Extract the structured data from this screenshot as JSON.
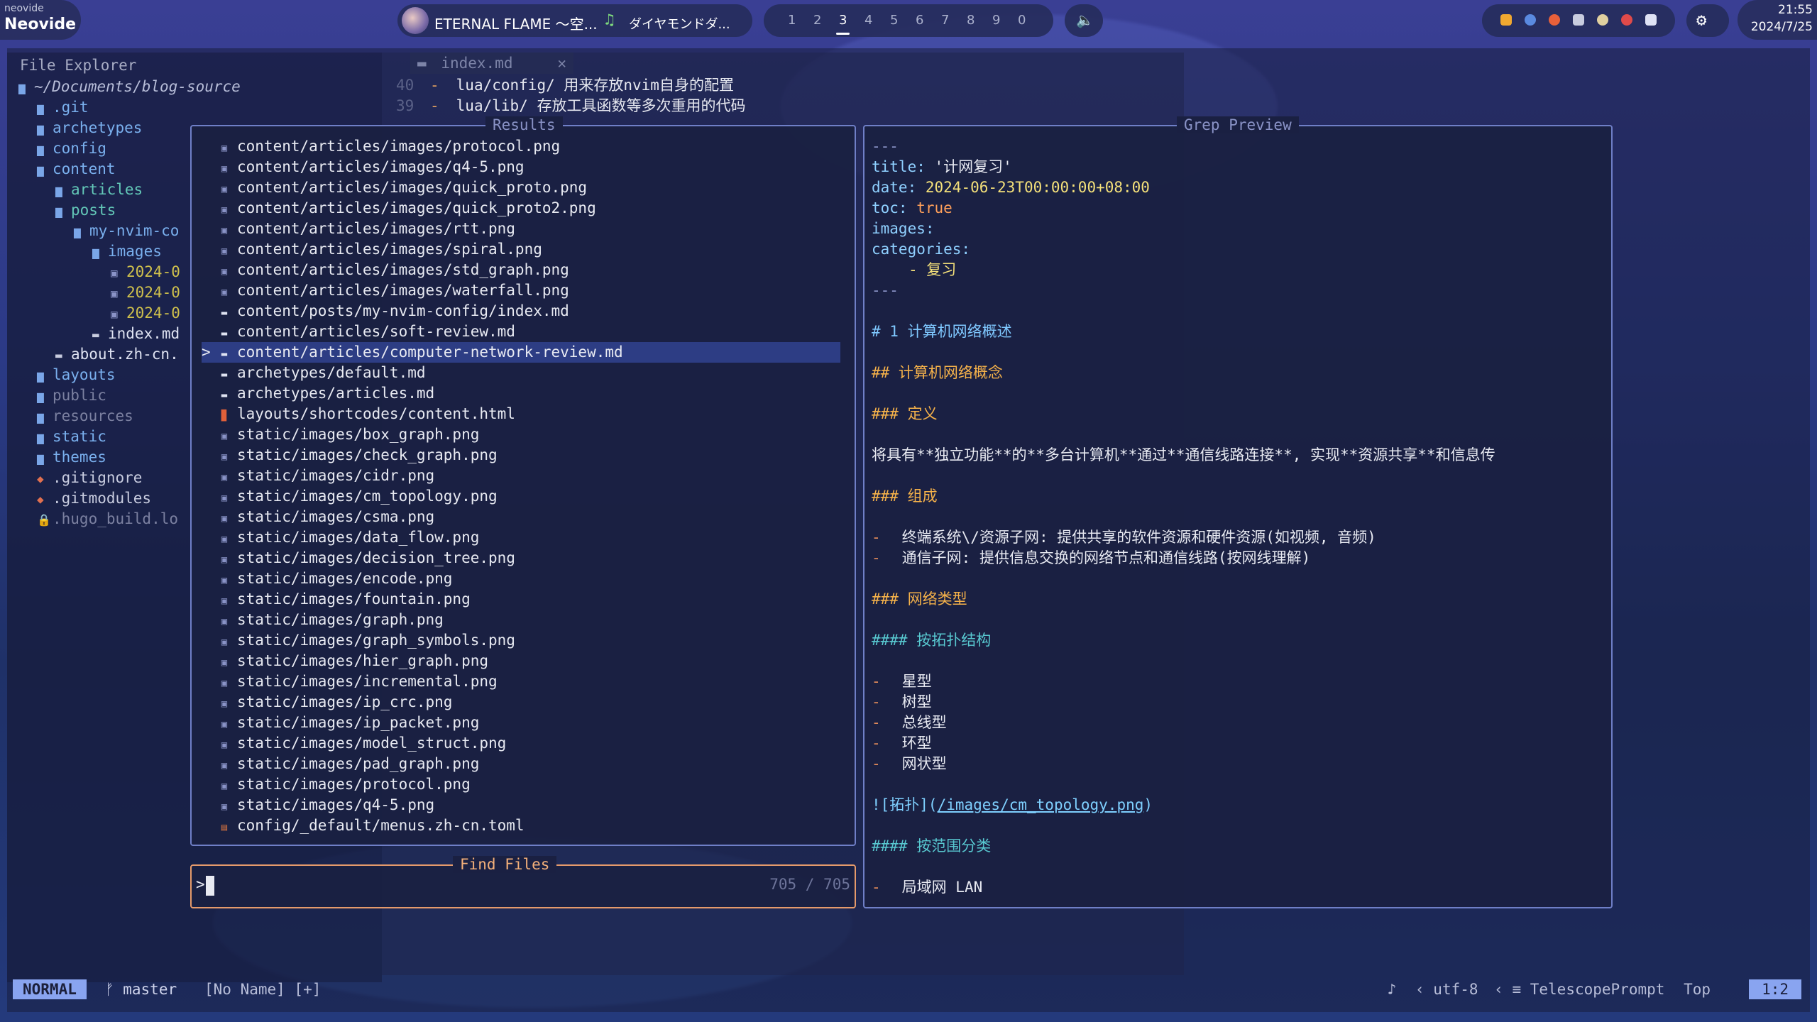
{
  "topbar": {
    "app_sub": "neovide",
    "app_name": "Neovide",
    "music_title": "ETERNAL FLAME 〜空...",
    "music_artist": "ダイヤモンドダ...",
    "workspaces": [
      "1",
      "2",
      "3",
      "4",
      "5",
      "6",
      "7",
      "8",
      "9",
      "0"
    ],
    "active_workspace": "3",
    "time": "21:55",
    "date": "2024/7/25"
  },
  "explorer": {
    "title": "File Explorer",
    "root": "~/Documents/blog-source",
    "items": [
      {
        "label": ".git",
        "type": "dir",
        "depth": 1
      },
      {
        "label": "archetypes",
        "type": "dir",
        "depth": 1
      },
      {
        "label": "config",
        "type": "dir",
        "depth": 1
      },
      {
        "label": "content",
        "type": "dir",
        "depth": 1
      },
      {
        "label": "articles",
        "type": "dir",
        "depth": 2
      },
      {
        "label": "posts",
        "type": "dir",
        "depth": 2
      },
      {
        "label": "my-nvim-co",
        "type": "dir",
        "depth": 3
      },
      {
        "label": "images",
        "type": "dir",
        "depth": 4
      },
      {
        "label": "2024-0",
        "type": "img",
        "depth": 5
      },
      {
        "label": "2024-0",
        "type": "img",
        "depth": 5
      },
      {
        "label": "2024-0",
        "type": "img",
        "depth": 5
      },
      {
        "label": "index.md",
        "type": "md",
        "depth": 4
      },
      {
        "label": "about.zh-cn.",
        "type": "md",
        "depth": 2
      },
      {
        "label": "layouts",
        "type": "dir",
        "depth": 1
      },
      {
        "label": "public",
        "type": "dim",
        "depth": 1
      },
      {
        "label": "resources",
        "type": "dim",
        "depth": 1
      },
      {
        "label": "static",
        "type": "dir",
        "depth": 1
      },
      {
        "label": "themes",
        "type": "dir",
        "depth": 1
      },
      {
        "label": ".gitignore",
        "type": "git",
        "depth": 1
      },
      {
        "label": ".gitmodules",
        "type": "git",
        "depth": 1
      },
      {
        "label": ".hugo_build.lo",
        "type": "lock",
        "depth": 1
      }
    ]
  },
  "editor": {
    "tab": "index.md",
    "lines": [
      {
        "ln": "40",
        "text": "lua/config/ 用来存放nvim自身的配置"
      },
      {
        "ln": "39",
        "text": "lua/lib/ 存放工具函数等多次重用的代码"
      }
    ]
  },
  "telescope": {
    "results_title": "Results",
    "preview_title": "Grep Preview",
    "prompt_title": "Find Files",
    "prompt_symbol": ">",
    "count": "705 / 705",
    "selected_index": 10,
    "results": [
      {
        "path": "content/articles/images/protocol.png",
        "icon": "img"
      },
      {
        "path": "content/articles/images/q4-5.png",
        "icon": "img"
      },
      {
        "path": "content/articles/images/quick_proto.png",
        "icon": "img"
      },
      {
        "path": "content/articles/images/quick_proto2.png",
        "icon": "img"
      },
      {
        "path": "content/articles/images/rtt.png",
        "icon": "img"
      },
      {
        "path": "content/articles/images/spiral.png",
        "icon": "img"
      },
      {
        "path": "content/articles/images/std_graph.png",
        "icon": "img"
      },
      {
        "path": "content/articles/images/waterfall.png",
        "icon": "img"
      },
      {
        "path": "content/posts/my-nvim-config/index.md",
        "icon": "md"
      },
      {
        "path": "content/articles/soft-review.md",
        "icon": "md"
      },
      {
        "path": "content/articles/computer-network-review.md",
        "icon": "md"
      },
      {
        "path": "archetypes/default.md",
        "icon": "md"
      },
      {
        "path": "archetypes/articles.md",
        "icon": "md"
      },
      {
        "path": "layouts/shortcodes/content.html",
        "icon": "html"
      },
      {
        "path": "static/images/box_graph.png",
        "icon": "img"
      },
      {
        "path": "static/images/check_graph.png",
        "icon": "img"
      },
      {
        "path": "static/images/cidr.png",
        "icon": "img"
      },
      {
        "path": "static/images/cm_topology.png",
        "icon": "img"
      },
      {
        "path": "static/images/csma.png",
        "icon": "img"
      },
      {
        "path": "static/images/data_flow.png",
        "icon": "img"
      },
      {
        "path": "static/images/decision_tree.png",
        "icon": "img"
      },
      {
        "path": "static/images/encode.png",
        "icon": "img"
      },
      {
        "path": "static/images/fountain.png",
        "icon": "img"
      },
      {
        "path": "static/images/graph.png",
        "icon": "img"
      },
      {
        "path": "static/images/graph_symbols.png",
        "icon": "img"
      },
      {
        "path": "static/images/hier_graph.png",
        "icon": "img"
      },
      {
        "path": "static/images/incremental.png",
        "icon": "img"
      },
      {
        "path": "static/images/ip_crc.png",
        "icon": "img"
      },
      {
        "path": "static/images/ip_packet.png",
        "icon": "img"
      },
      {
        "path": "static/images/model_struct.png",
        "icon": "img"
      },
      {
        "path": "static/images/pad_graph.png",
        "icon": "img"
      },
      {
        "path": "static/images/protocol.png",
        "icon": "img"
      },
      {
        "path": "static/images/q4-5.png",
        "icon": "img"
      },
      {
        "path": "config/_default/menus.zh-cn.toml",
        "icon": "toml"
      }
    ],
    "preview": {
      "fm_sep": "---",
      "title_key": "title:",
      "title_val": "'计网复习'",
      "date_key": "date:",
      "date_val": "2024-06-23T00:00:00+08:00",
      "toc_key": "toc:",
      "toc_val": "true",
      "images_key": "images:",
      "cat_key": "categories:",
      "cat_item": "- 复习",
      "h1": "# 1 计算机网络概述",
      "h2": "## 计算机网络概念",
      "h3_def": "### 定义",
      "def_text": "将具有**独立功能**的**多台计算机**通过**通信线路连接**, 实现**资源共享**和信息传",
      "h3_comp": "### 组成",
      "comp_items": [
        "终端系统\\/资源子网: 提供共享的软件资源和硬件资源(如视频, 音频)",
        "通信子网: 提供信息交换的网络节点和通信线路(按网线理解)"
      ],
      "h3_type": "### 网络类型",
      "h4_topo": "#### 按拓扑结构",
      "topo_items": [
        "星型",
        "树型",
        "总线型",
        "环型",
        "网状型"
      ],
      "img_alt": "![拓扑](",
      "img_link": "/images/cm_topology.png",
      "img_close": ")",
      "h4_range": "#### 按范围分类",
      "range_item": "局域网 LAN"
    }
  },
  "statusline": {
    "mode": "NORMAL",
    "branch": "master",
    "buffer": "[No Name] [+]",
    "encoding": "utf-8",
    "filetype": "TelescopePrompt",
    "scroll": "Top",
    "position": "1:2"
  },
  "colors": {
    "accent": "#89a4f0",
    "border": "#6f7fc7",
    "prompt_border": "#e59a6b",
    "selection": "#2d3d84"
  }
}
